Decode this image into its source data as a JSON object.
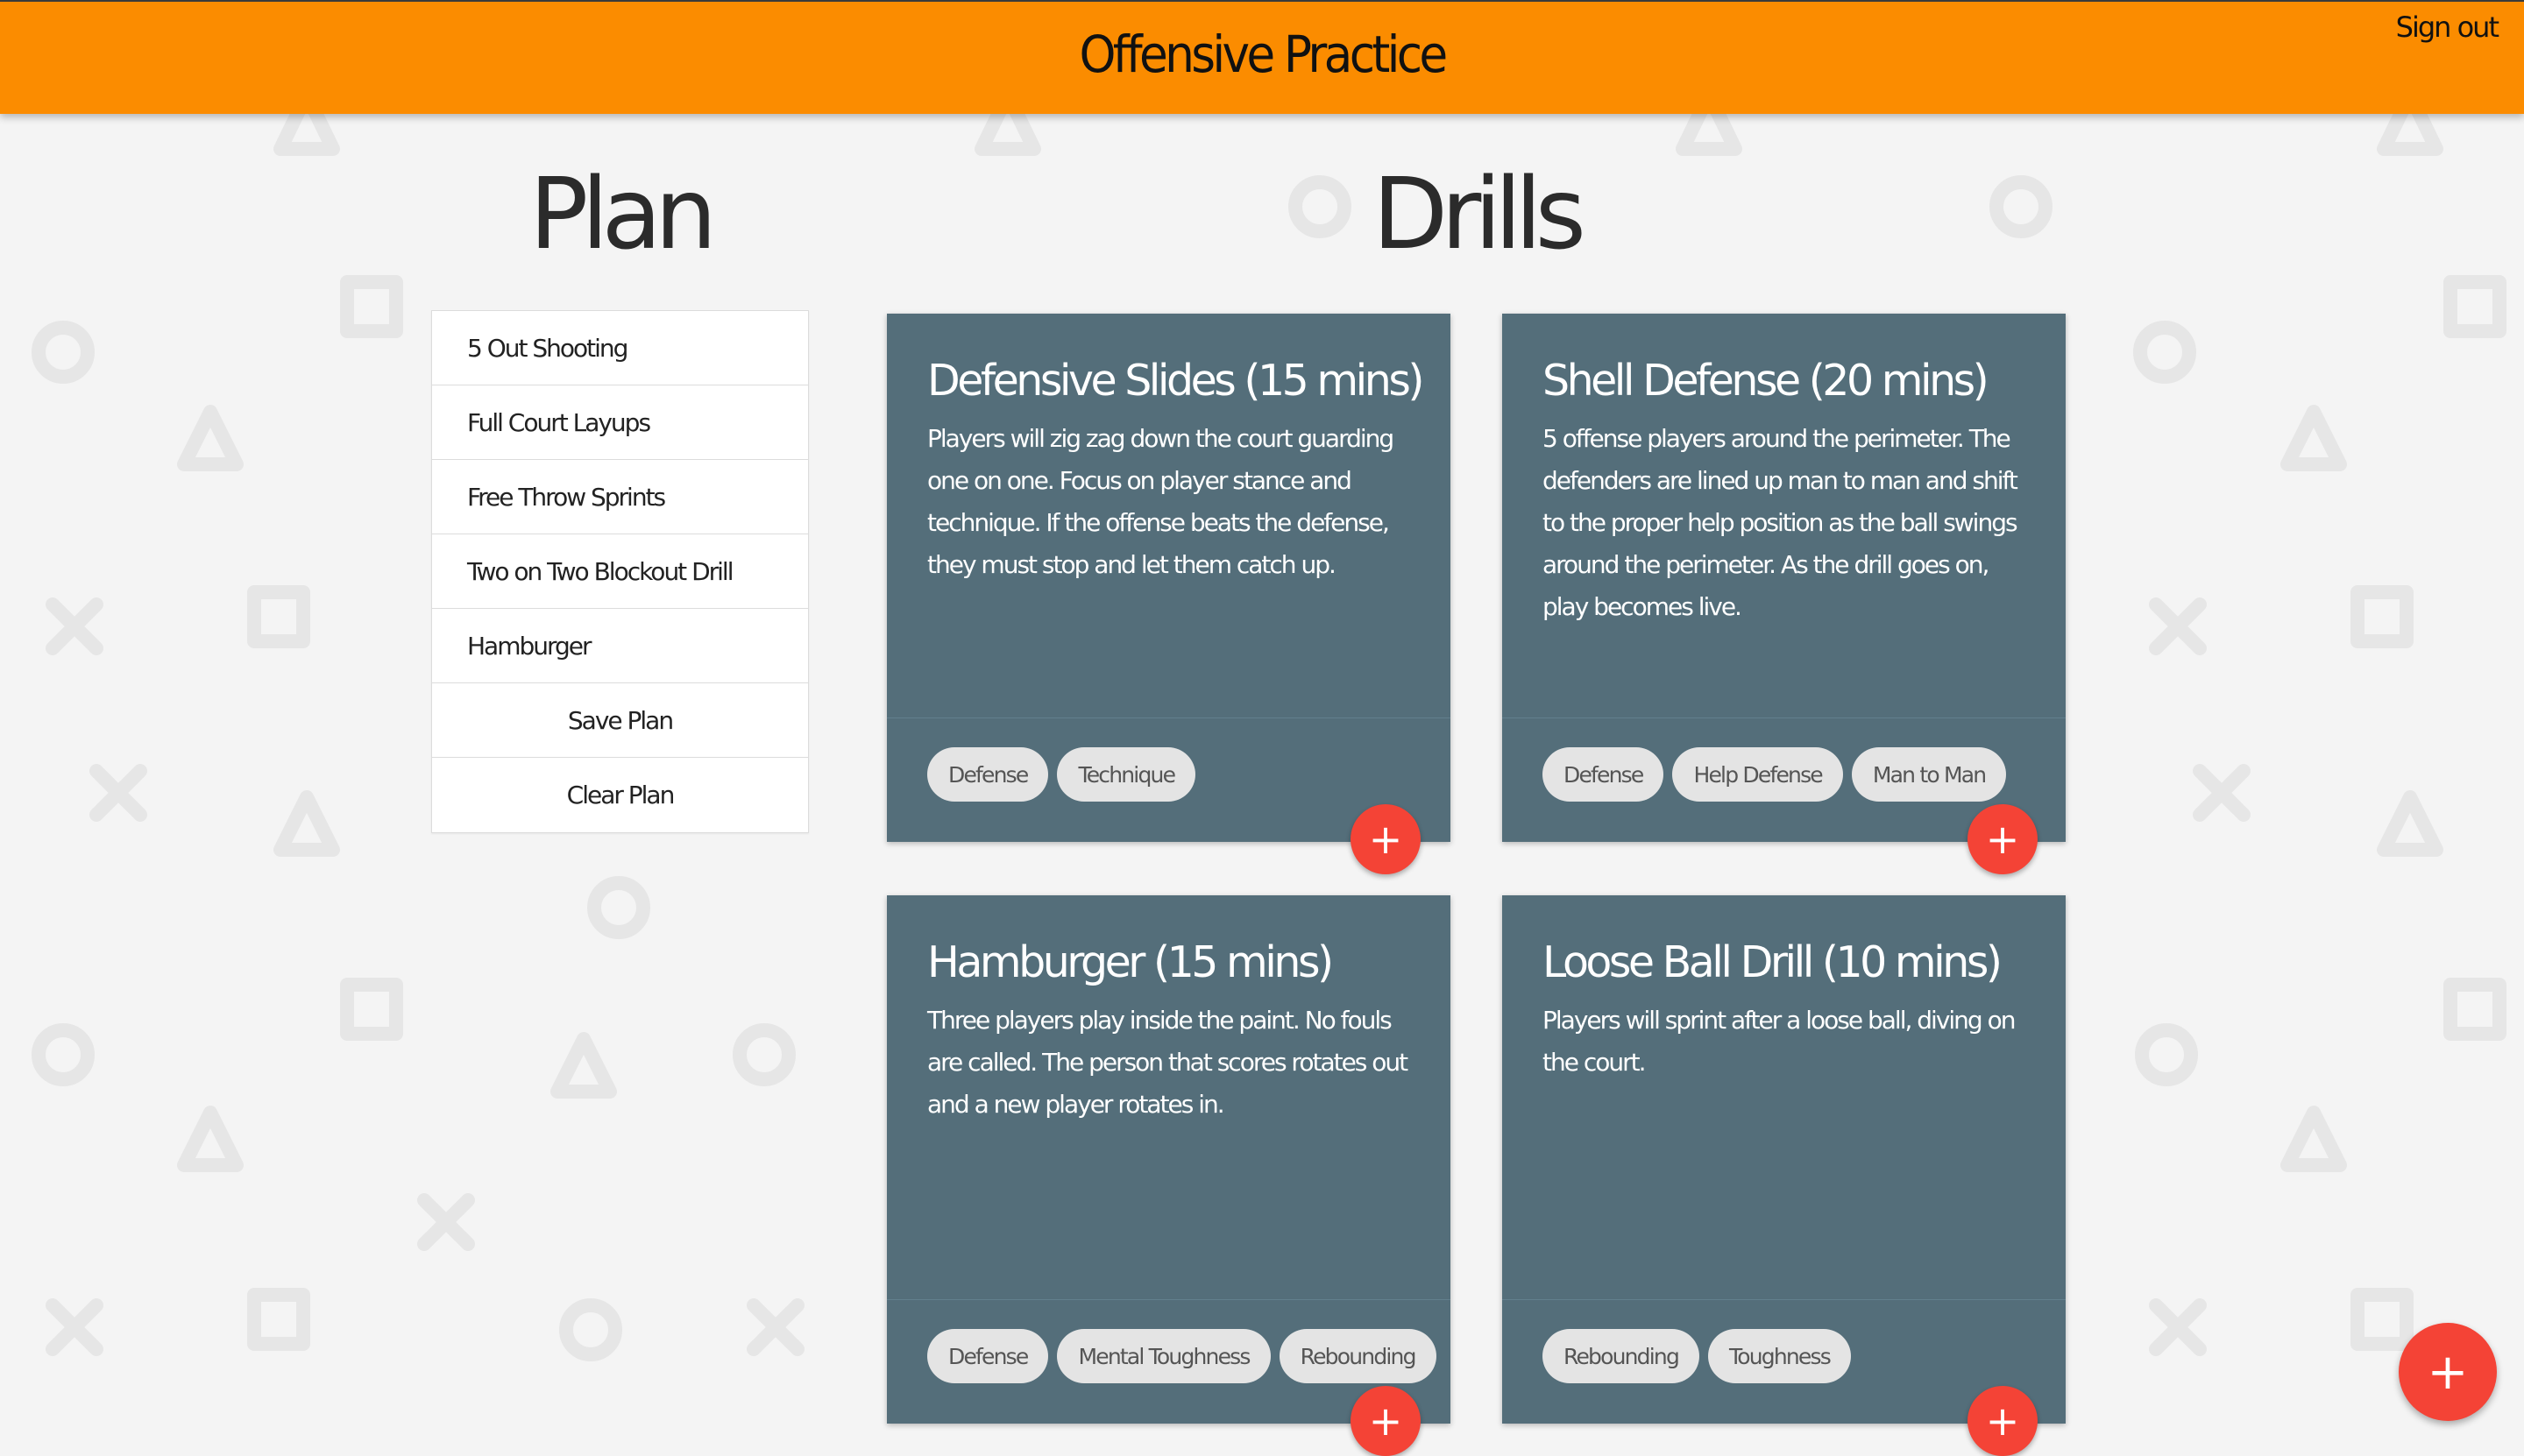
{
  "header": {
    "title": "Offensive Practice",
    "sign_out": "Sign out"
  },
  "plan": {
    "title": "Plan",
    "items": [
      {
        "label": "5 Out Shooting"
      },
      {
        "label": "Full Court Layups"
      },
      {
        "label": "Free Throw Sprints"
      },
      {
        "label": "Two on Two Blockout Drill"
      },
      {
        "label": "Hamburger"
      }
    ],
    "save_label": "Save Plan",
    "clear_label": "Clear Plan"
  },
  "drills": {
    "title": "Drills",
    "cards": [
      {
        "title": "Defensive Slides (15 mins)",
        "description": "Players will zig zag down the court guarding one on one. Focus on player stance and technique. If the offense beats the defense, they must stop and let them catch up.",
        "tags": [
          "Defense",
          "Technique"
        ],
        "add_label": "+"
      },
      {
        "title": "Shell Defense (20 mins)",
        "description": "5 offense players around the perimeter. The defenders are lined up man to man and shift to the proper help position as the ball swings around the perimeter. As the drill goes on, play becomes live.",
        "tags": [
          "Defense",
          "Help Defense",
          "Man to Man"
        ],
        "add_label": "+"
      },
      {
        "title": "Hamburger (15 mins)",
        "description": "Three players play inside the paint. No fouls are called. The person that scores rotates out and a new player rotates in.",
        "tags": [
          "Defense",
          "Mental Toughness",
          "Rebounding"
        ],
        "add_label": "+"
      },
      {
        "title": "Loose Ball Drill (10 mins)",
        "description": "Players will sprint after a loose ball, diving on the court.",
        "tags": [
          "Rebounding",
          "Toughness"
        ],
        "add_label": "+"
      }
    ]
  },
  "fab": {
    "label": "+"
  },
  "colors": {
    "header": "#fb8c00",
    "card": "#546e7a",
    "fab": "#f44336",
    "tag": "#e4e4e4",
    "background": "#f4f4f4",
    "pattern": "#e6e6e6"
  },
  "icons": {
    "add": "plus-icon",
    "background_pattern": [
      "triangle-icon",
      "circle-icon",
      "square-icon",
      "cross-icon"
    ]
  }
}
